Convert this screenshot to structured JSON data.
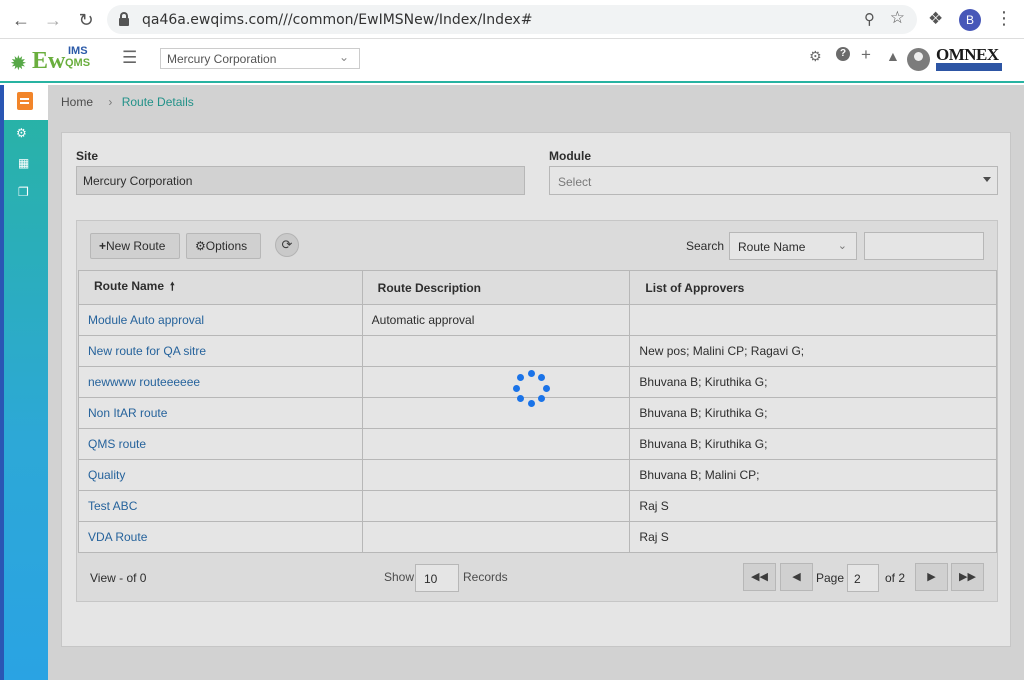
{
  "browser": {
    "url": "qa46a.ewqims.com///common/EwIMSNew/Index/Index#",
    "profile_initial": "B"
  },
  "header": {
    "logo": {
      "ew": "Ew",
      "ims": "IMS",
      "qms": "QMS"
    },
    "site_select": "Mercury Corporation",
    "brand": "OMNEX"
  },
  "breadcrumb": {
    "home": "Home",
    "current": "Route Details"
  },
  "form": {
    "site_label": "Site",
    "site_value": "Mercury Corporation",
    "module_label": "Module",
    "module_value": "Select"
  },
  "toolbar": {
    "new_route": "New Route",
    "options": "Options",
    "search_label": "Search",
    "search_field": "Route Name"
  },
  "table": {
    "columns": [
      "Route Name",
      "Route Description",
      "List of Approvers"
    ],
    "rows": [
      {
        "name": "Module Auto approval",
        "description": "Automatic approval",
        "approvers": ""
      },
      {
        "name": "New route for QA sitre",
        "description": "",
        "approvers": "New pos; Malini CP; Ragavi G;"
      },
      {
        "name": "newwww routeeeeee",
        "description": "",
        "approvers": "Bhuvana B; Kiruthika G;"
      },
      {
        "name": "Non ItAR route",
        "description": "",
        "approvers": "Bhuvana B; Kiruthika G;"
      },
      {
        "name": "QMS route",
        "description": "",
        "approvers": "Bhuvana B; Kiruthika G;"
      },
      {
        "name": "Quality",
        "description": "",
        "approvers": "Bhuvana B; Malini CP;"
      },
      {
        "name": "Test ABC",
        "description": "",
        "approvers": "Raj S"
      },
      {
        "name": "VDA Route",
        "description": "",
        "approvers": "Raj S"
      }
    ]
  },
  "pager": {
    "view_text": "View - of 0",
    "show_label": "Show",
    "show_value": "10",
    "records_label": "Records",
    "page_label": "Page",
    "page_value": "2",
    "of_label": "of",
    "total_pages": "2"
  },
  "colors": {
    "accent": "#28b3a2",
    "link": "#2b6fae",
    "spinner": "#1a73e8"
  }
}
